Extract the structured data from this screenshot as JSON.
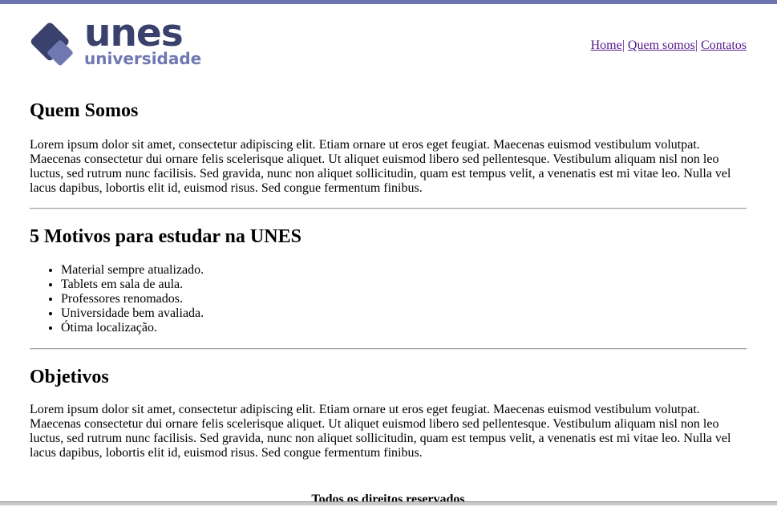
{
  "brand": {
    "word": "unes",
    "sub": "universidade",
    "colors": {
      "primary": "#3a416d",
      "secondary": "#6f78b0",
      "strip": "#6c75ad"
    }
  },
  "nav": {
    "items": [
      {
        "label": "Home"
      },
      {
        "label": "Quem somos"
      },
      {
        "label": "Contatos"
      }
    ],
    "separator": "|"
  },
  "sections": {
    "about": {
      "title": "Quem Somos",
      "text": "Lorem ipsum dolor sit amet, consectetur adipiscing elit. Etiam ornare ut eros eget feugiat. Maecenas euismod vestibulum volutpat. Maecenas consectetur dui ornare felis scelerisque aliquet. Ut aliquet euismod libero sed pellentesque. Vestibulum aliquam nisl non leo luctus, sed rutrum nunc facilisis. Sed gravida, nunc non aliquet sollicitudin, quam est tempus velit, a venenatis est mi vitae leo. Nulla vel lacus dapibus, lobortis elit id, euismod risus. Sed congue fermentum finibus."
    },
    "reasons": {
      "title": "5 Motivos para estudar na UNES",
      "items": [
        "Material sempre atualizado.",
        "Tablets em sala de aula.",
        "Professores renomados.",
        "Universidade bem avaliada.",
        "Ótima localização."
      ]
    },
    "goals": {
      "title": "Objetivos",
      "text": "Lorem ipsum dolor sit amet, consectetur adipiscing elit. Etiam ornare ut eros eget feugiat. Maecenas euismod vestibulum volutpat. Maecenas consectetur dui ornare felis scelerisque aliquet. Ut aliquet euismod libero sed pellentesque. Vestibulum aliquam nisl non leo luctus, sed rutrum nunc facilisis. Sed gravida, nunc non aliquet sollicitudin, quam est tempus velit, a venenatis est mi vitae leo. Nulla vel lacus dapibus, lobortis elit id, euismod risus. Sed congue fermentum finibus."
    }
  },
  "footer": {
    "text": "Todos os direitos reservados"
  }
}
